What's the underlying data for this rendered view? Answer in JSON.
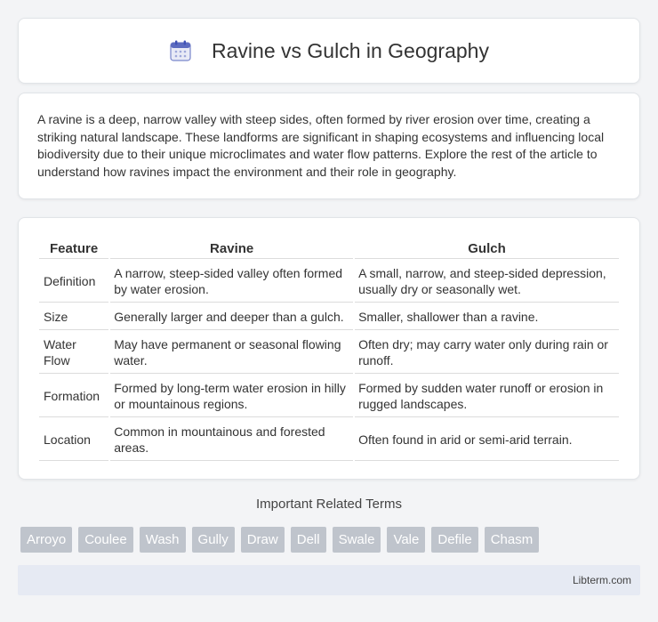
{
  "header": {
    "title": "Ravine vs Gulch in Geography",
    "icon": "calendar-icon"
  },
  "intro": {
    "text": "A ravine is a deep, narrow valley with steep sides, often formed by river erosion over time, creating a striking natural landscape. These landforms are significant in shaping ecosystems and influencing local biodiversity due to their unique microclimates and water flow patterns. Explore the rest of the article to understand how ravines impact the environment and their role in geography."
  },
  "table": {
    "headers": [
      "Feature",
      "Ravine",
      "Gulch"
    ],
    "rows": [
      {
        "feature": "Definition",
        "ravine": "A narrow, steep-sided valley often formed by water erosion.",
        "gulch": "A small, narrow, and steep-sided depression, usually dry or seasonally wet."
      },
      {
        "feature": "Size",
        "ravine": "Generally larger and deeper than a gulch.",
        "gulch": "Smaller, shallower than a ravine."
      },
      {
        "feature": "Water Flow",
        "ravine": "May have permanent or seasonal flowing water.",
        "gulch": "Often dry; may carry water only during rain or runoff."
      },
      {
        "feature": "Formation",
        "ravine": "Formed by long-term water erosion in hilly or mountainous regions.",
        "gulch": "Formed by sudden water runoff or erosion in rugged landscapes."
      },
      {
        "feature": "Location",
        "ravine": "Common in mountainous and forested areas.",
        "gulch": "Often found in arid or semi-arid terrain."
      }
    ]
  },
  "related": {
    "title": "Important Related Terms",
    "tags": [
      "Arroyo",
      "Coulee",
      "Wash",
      "Gully",
      "Draw",
      "Dell",
      "Swale",
      "Vale",
      "Defile",
      "Chasm"
    ]
  },
  "footer": {
    "text": "Libterm.com"
  }
}
